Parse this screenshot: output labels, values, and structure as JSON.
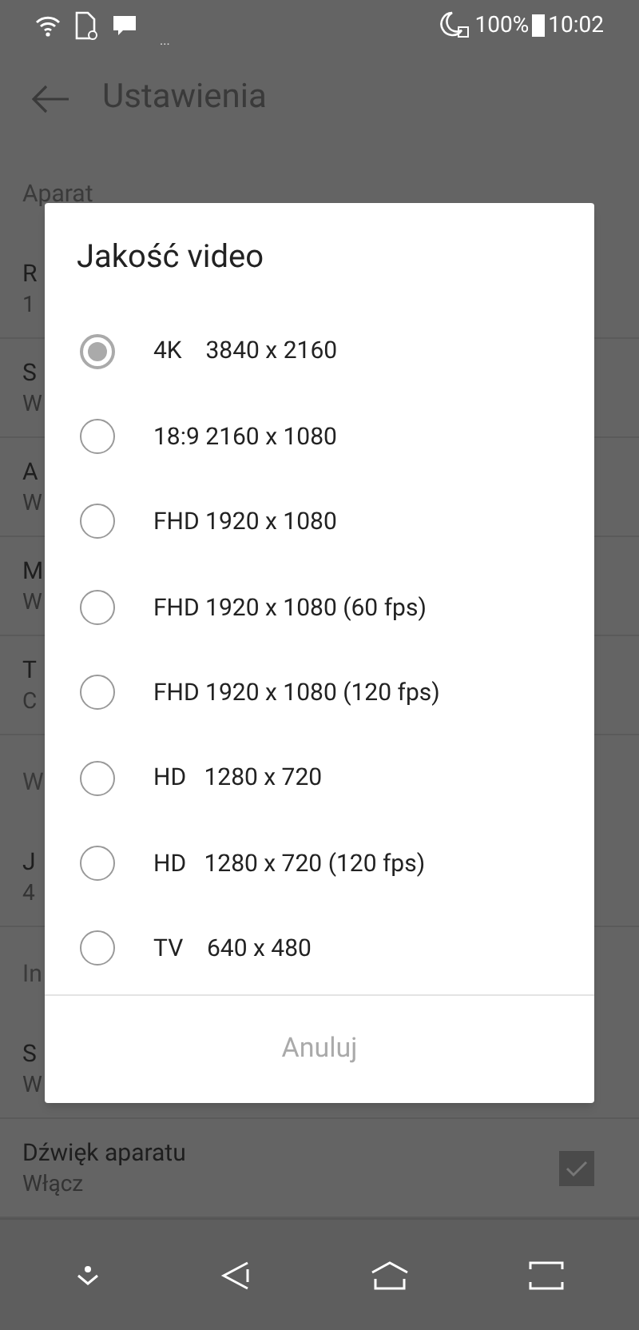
{
  "status_bar": {
    "battery": "100%",
    "time": "10:02",
    "notification_dots": "..."
  },
  "header": {
    "title": "Ustawienia"
  },
  "settings": [
    {
      "kind": "section",
      "title": "Aparat"
    },
    {
      "kind": "item",
      "title": "R",
      "subtitle": "1"
    },
    {
      "kind": "item",
      "title": "S",
      "subtitle": "W"
    },
    {
      "kind": "item",
      "title": "A",
      "subtitle": "W"
    },
    {
      "kind": "item",
      "title": "M",
      "subtitle": "W"
    },
    {
      "kind": "item",
      "title": "T",
      "subtitle": "C"
    },
    {
      "kind": "section",
      "title": "W"
    },
    {
      "kind": "item",
      "title": "J",
      "subtitle": "4"
    },
    {
      "kind": "section",
      "title": "In"
    },
    {
      "kind": "item",
      "title": "S",
      "subtitle": "W"
    },
    {
      "kind": "toggle",
      "title": "Dźwięk aparatu",
      "subtitle": "Włącz",
      "checked": true
    }
  ],
  "dialog": {
    "title": "Jakość video",
    "options": [
      {
        "label": "4K    3840 x 2160",
        "selected": true
      },
      {
        "label": "18:9 2160 x 1080",
        "selected": false
      },
      {
        "label": "FHD 1920 x 1080",
        "selected": false
      },
      {
        "label": "FHD 1920 x 1080 (60 fps)",
        "selected": false
      },
      {
        "label": "FHD 1920 x 1080 (120 fps)",
        "selected": false
      },
      {
        "label": "HD   1280 x 720",
        "selected": false
      },
      {
        "label": "HD   1280 x 720 (120 fps)",
        "selected": false
      },
      {
        "label": "TV    640 x 480",
        "selected": false
      }
    ],
    "cancel": "Anuluj"
  }
}
